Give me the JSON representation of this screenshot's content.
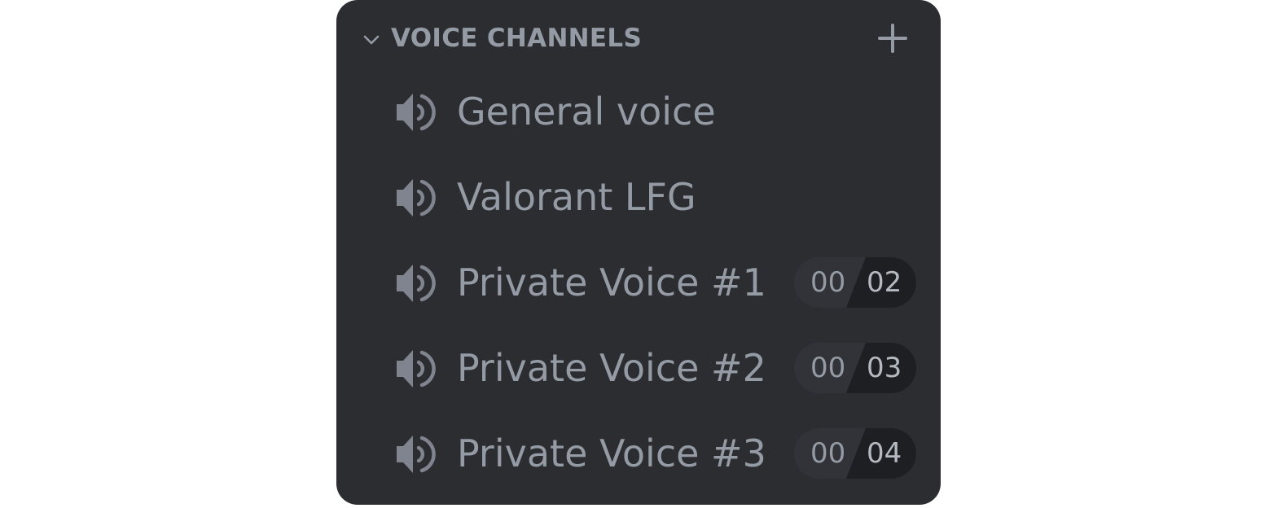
{
  "section": {
    "title": "VOICE CHANNELS",
    "collapse_icon": "chevron-down-icon",
    "add_icon": "plus-icon"
  },
  "channels": [
    {
      "name": "General voice",
      "icon": "speaker-icon",
      "user_count": null,
      "user_limit": null
    },
    {
      "name": "Valorant LFG",
      "icon": "speaker-icon",
      "user_count": null,
      "user_limit": null
    },
    {
      "name": "Private Voice #1",
      "icon": "speaker-icon",
      "user_count": "00",
      "user_limit": "02"
    },
    {
      "name": "Private Voice #2",
      "icon": "speaker-icon",
      "user_count": "00",
      "user_limit": "03"
    },
    {
      "name": "Private Voice #3",
      "icon": "speaker-icon",
      "user_count": "00",
      "user_limit": "04"
    }
  ],
  "colors": {
    "panel_bg": "#2b2d31",
    "text_muted": "#949ba4",
    "counter_left_bg": "#313338",
    "counter_right_bg": "#1e1f22"
  }
}
